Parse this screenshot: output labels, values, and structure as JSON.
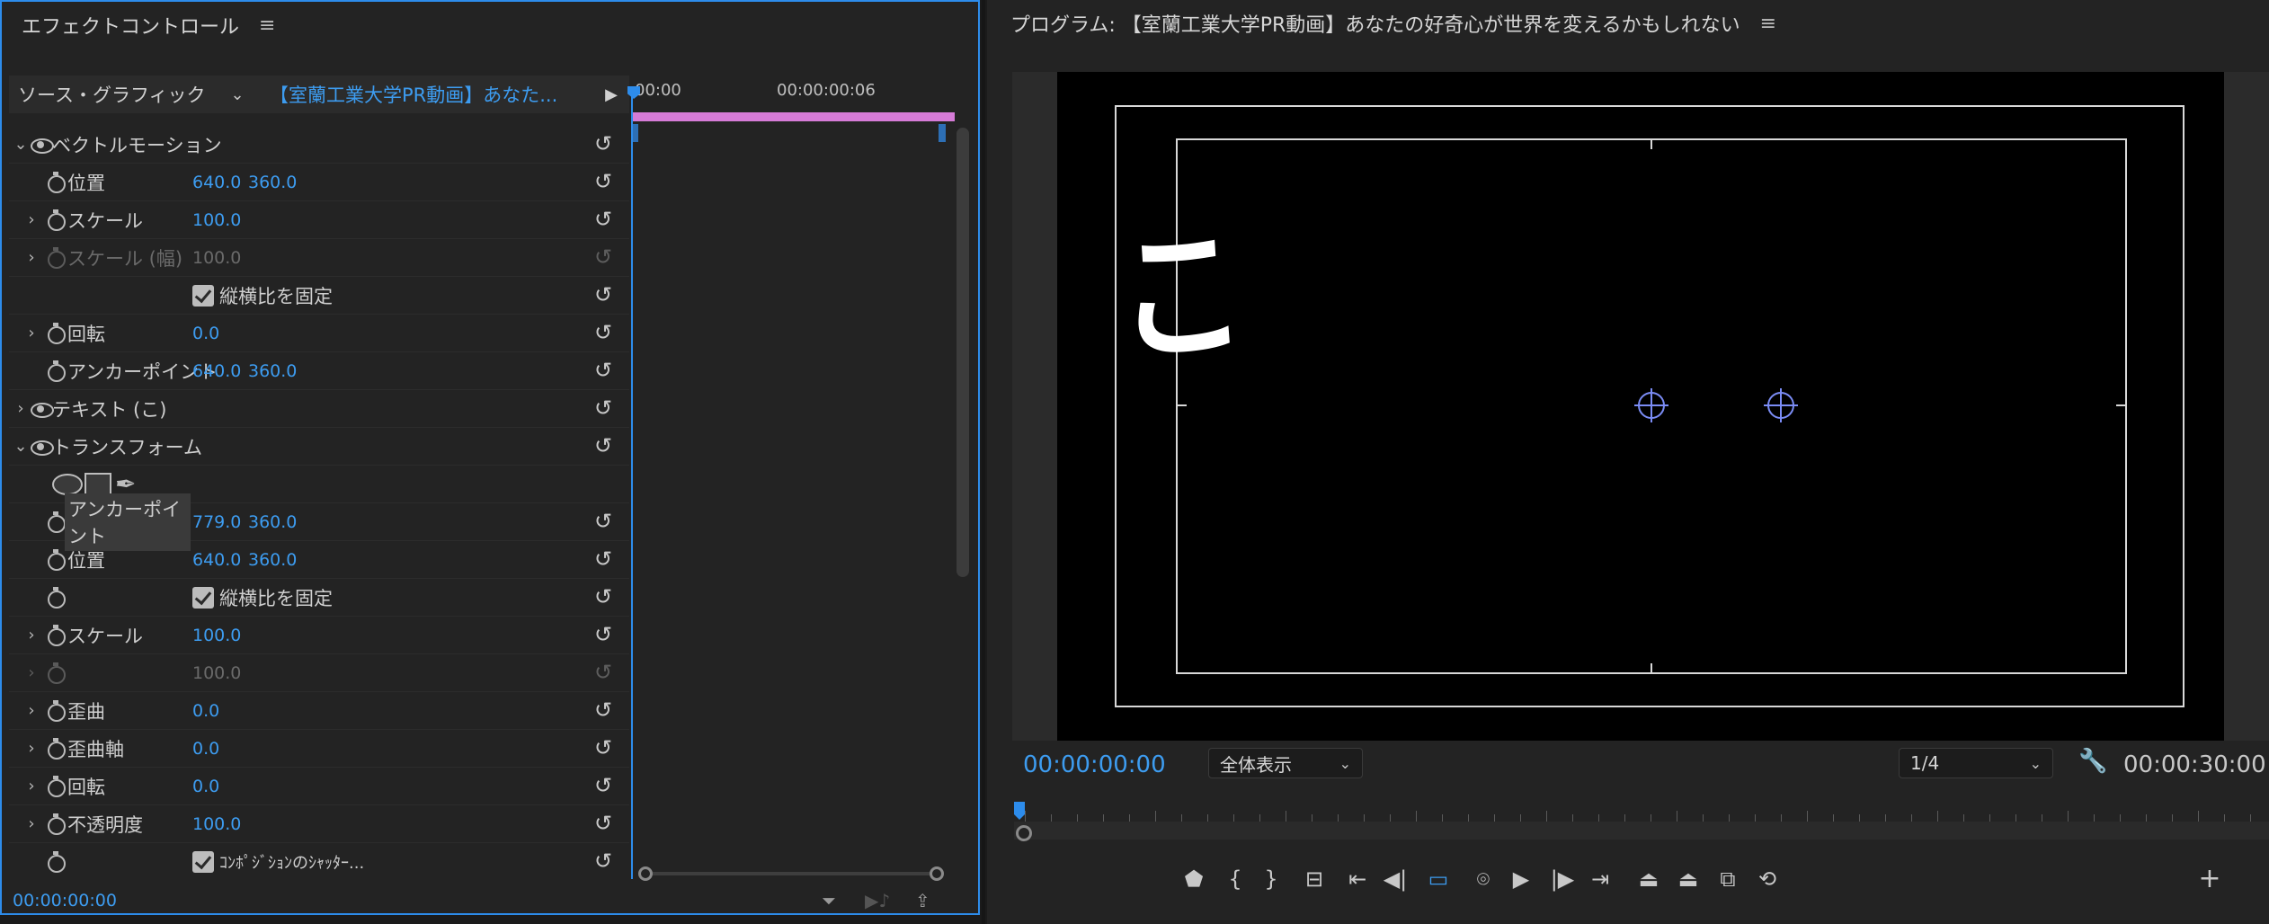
{
  "effect_controls": {
    "title": "エフェクトコントロール",
    "menu_glyph": "≡",
    "source_label": "ソース・グラフィック",
    "source_dropdown_glyph": "⌄",
    "clip_name": "【室蘭工業大学PR動画】あなた...",
    "play_glyph": "▶",
    "rows": {
      "vector_motion": "ベクトルモーション",
      "vm_position": "位置",
      "vm_position_x": "640.0",
      "vm_position_y": "360.0",
      "vm_scale": "スケール",
      "vm_scale_val": "100.0",
      "vm_scale_width": "スケール (幅)",
      "vm_scale_width_val": "100.0",
      "vm_uniform": "縦横比を固定",
      "vm_rotation": "回転",
      "vm_rotation_val": "0.0",
      "vm_anchor": "アンカーポイント",
      "vm_anchor_x": "640.0",
      "vm_anchor_y": "360.0",
      "text_layer": "テキスト (こ)",
      "transform": "トランスフォーム",
      "tf_anchor": "アンカーポイント",
      "tf_anchor_x": "779.0",
      "tf_anchor_y": "360.0",
      "tf_position": "位置",
      "tf_position_x": "640.0",
      "tf_position_y": "360.0",
      "tf_uniform": "縦横比を固定",
      "tf_scale": "スケール",
      "tf_scale_val": "100.0",
      "tf_scale_width_val": "100.0",
      "tf_skew": "歪曲",
      "tf_skew_val": "0.0",
      "tf_skew_axis": "歪曲軸",
      "tf_skew_axis_val": "0.0",
      "tf_rotation": "回転",
      "tf_rotation_val": "0.0",
      "tf_opacity": "不透明度",
      "tf_opacity_val": "100.0",
      "tf_shutter": "ｺﾝﾎﾟｼﾞｼｮﾝのｼｬｯﾀｰ..."
    },
    "timeline": {
      "start_tc": "00:00",
      "mid_tc": "00:00:00:06"
    },
    "footer_tc": "00:00:00:00"
  },
  "program_monitor": {
    "title": "プログラム: 【室蘭工業大学PR動画】あなたの好奇心が世界を変えるかもしれない",
    "menu_glyph": "≡",
    "preview_text": "こ",
    "current_tc": "00:00:00:00",
    "zoom": "全体表示",
    "resolution": "1/4",
    "duration_tc": "00:00:30:00"
  },
  "colors": {
    "accent": "#2d8ceb",
    "value_blue": "#3d9cf0",
    "clip_pink": "#d67bd7"
  }
}
